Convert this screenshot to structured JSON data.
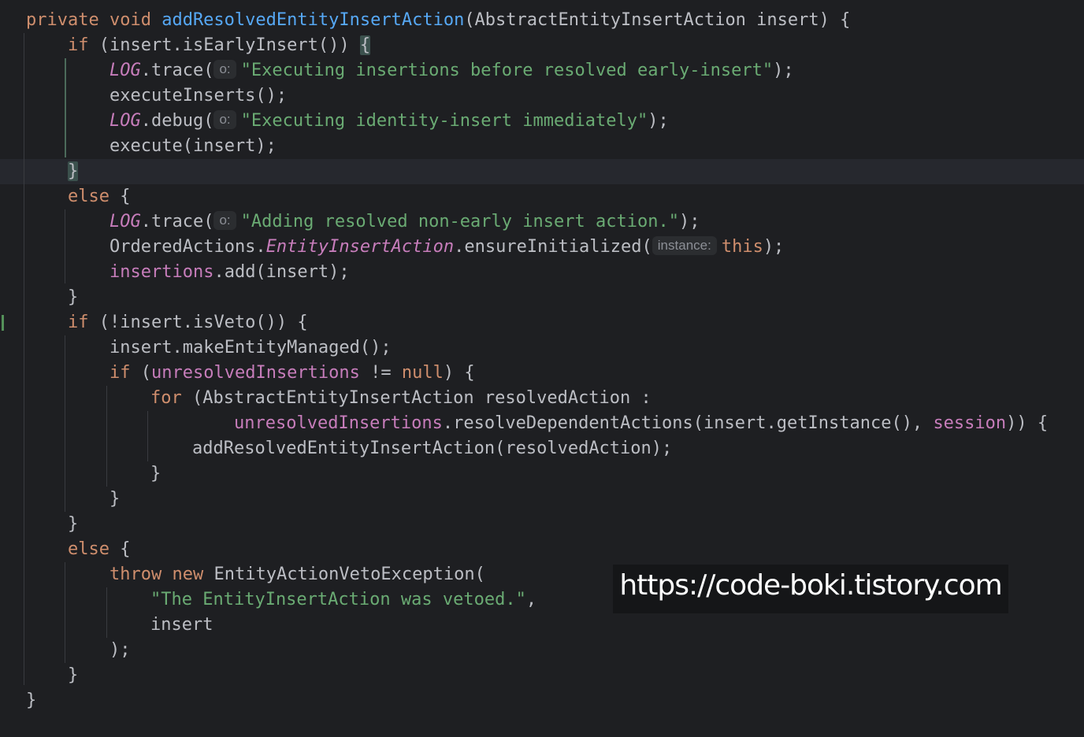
{
  "editor": {
    "current_line": 7,
    "lines": [
      [
        {
          "t": "private ",
          "c": "kw"
        },
        {
          "t": "void ",
          "c": "kw"
        },
        {
          "t": "addResolvedEntityInsertAction",
          "c": "fn"
        },
        {
          "t": "(AbstractEntityInsertAction insert) {",
          "c": ""
        }
      ],
      [
        {
          "t": "if",
          "c": "kw"
        },
        {
          "t": " (insert.isEarlyInsert()) ",
          "c": ""
        },
        {
          "t": "{",
          "c": "brace-hl"
        }
      ],
      [
        {
          "t": "LOG",
          "c": "static"
        },
        {
          "t": ".trace(",
          "c": ""
        },
        {
          "h": "o:"
        },
        {
          "t": "\"Executing insertions before resolved early-insert\"",
          "c": "str"
        },
        {
          "t": ");",
          "c": ""
        }
      ],
      [
        {
          "t": "executeInserts();",
          "c": ""
        }
      ],
      [
        {
          "t": "LOG",
          "c": "static"
        },
        {
          "t": ".debug(",
          "c": ""
        },
        {
          "h": "o:"
        },
        {
          "t": "\"Executing identity-insert immediately\"",
          "c": "str"
        },
        {
          "t": ");",
          "c": ""
        }
      ],
      [
        {
          "t": "execute(insert);",
          "c": ""
        }
      ],
      [
        {
          "t": "}",
          "c": "brace-hl"
        }
      ],
      [
        {
          "t": "else",
          "c": "kw"
        },
        {
          "t": " {",
          "c": ""
        }
      ],
      [
        {
          "t": "LOG",
          "c": "static"
        },
        {
          "t": ".trace(",
          "c": ""
        },
        {
          "h": "o:"
        },
        {
          "t": "\"Adding resolved non-early insert action.\"",
          "c": "str"
        },
        {
          "t": ");",
          "c": ""
        }
      ],
      [
        {
          "t": "OrderedActions.",
          "c": ""
        },
        {
          "t": "EntityInsertAction",
          "c": "static"
        },
        {
          "t": ".ensureInitialized(",
          "c": ""
        },
        {
          "h": "instance:"
        },
        {
          "t": "this",
          "c": "kw"
        },
        {
          "t": ");",
          "c": ""
        }
      ],
      [
        {
          "t": "insertions",
          "c": "field"
        },
        {
          "t": ".add(insert);",
          "c": ""
        }
      ],
      [
        {
          "t": "}",
          "c": ""
        }
      ],
      [
        {
          "t": "if",
          "c": "kw"
        },
        {
          "t": " (!insert.isVeto()) {",
          "c": ""
        }
      ],
      [
        {
          "t": "insert.makeEntityManaged();",
          "c": ""
        }
      ],
      [
        {
          "t": "if",
          "c": "kw"
        },
        {
          "t": " (",
          "c": ""
        },
        {
          "t": "unresolvedInsertions",
          "c": "field"
        },
        {
          "t": " != ",
          "c": ""
        },
        {
          "t": "null",
          "c": "kw"
        },
        {
          "t": ") {",
          "c": ""
        }
      ],
      [
        {
          "t": "for",
          "c": "kw"
        },
        {
          "t": " (AbstractEntityInsertAction resolvedAction :",
          "c": ""
        }
      ],
      [
        {
          "t": "unresolvedInsertions",
          "c": "field"
        },
        {
          "t": ".resolveDependentActions(insert.getInstance(), ",
          "c": ""
        },
        {
          "t": "session",
          "c": "field"
        },
        {
          "t": ")) {",
          "c": ""
        }
      ],
      [
        {
          "t": "addResolvedEntityInsertAction(resolvedAction);",
          "c": ""
        }
      ],
      [
        {
          "t": "}",
          "c": ""
        }
      ],
      [
        {
          "t": "}",
          "c": ""
        }
      ],
      [
        {
          "t": "}",
          "c": ""
        }
      ],
      [
        {
          "t": "else",
          "c": "kw"
        },
        {
          "t": " {",
          "c": ""
        }
      ],
      [
        {
          "t": "throw",
          "c": "kw"
        },
        {
          "t": " ",
          "c": ""
        },
        {
          "t": "new",
          "c": "kw"
        },
        {
          "t": " EntityActionVetoException(",
          "c": ""
        }
      ],
      [
        {
          "t": "\"The EntityInsertAction was vetoed.\"",
          "c": "str"
        },
        {
          "t": ",",
          "c": ""
        }
      ],
      [
        {
          "t": "insert",
          "c": ""
        }
      ],
      [
        {
          "t": ");",
          "c": ""
        }
      ],
      [
        {
          "t": "}",
          "c": ""
        }
      ],
      [
        {
          "t": "}",
          "c": ""
        }
      ]
    ]
  },
  "watermark": {
    "text": "https://code-boki.tistory.com"
  }
}
